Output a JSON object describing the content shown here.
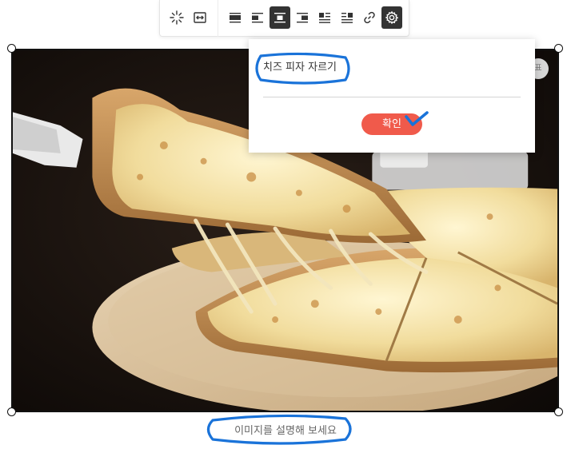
{
  "toolbar": {
    "buttons": [
      {
        "name": "magic-wand-icon",
        "active": false
      },
      {
        "name": "resize-width-icon",
        "active": false
      },
      {
        "name": "align-full-width-icon",
        "active": false
      },
      {
        "name": "align-left-icon",
        "active": false
      },
      {
        "name": "align-center-icon",
        "active": true
      },
      {
        "name": "align-right-icon",
        "active": false
      },
      {
        "name": "wrap-text-left-icon",
        "active": false
      },
      {
        "name": "wrap-text-right-icon",
        "active": false
      },
      {
        "name": "link-icon",
        "active": false
      },
      {
        "name": "gear-icon",
        "active": true
      }
    ]
  },
  "popup": {
    "alt_text_value": "치즈 피자 자르기",
    "confirm_label": "확인"
  },
  "image": {
    "subject": "cheese pizza slice being lifted with server"
  },
  "caption": {
    "placeholder": "이미지를 설명해 보세요"
  },
  "colors": {
    "accent": "#f05a4b",
    "annotation": "#1a73d9",
    "active_button": "#333333"
  }
}
